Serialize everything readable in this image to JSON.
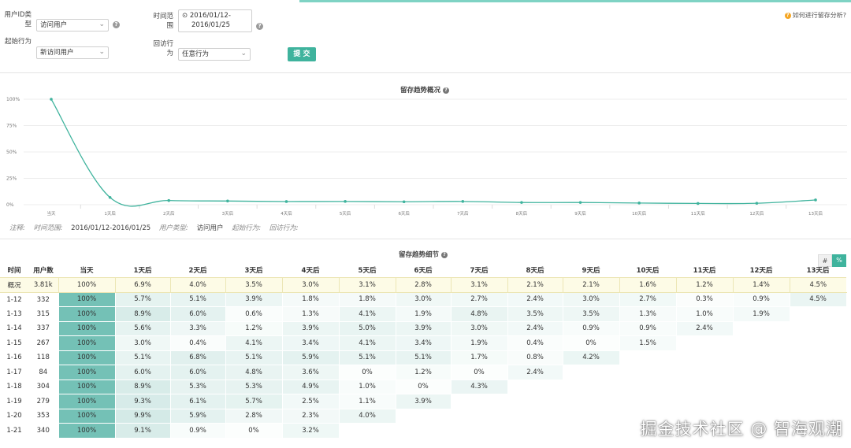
{
  "filters": {
    "user_id_type_label": "用户ID类型",
    "user_id_type_value": "访问用户",
    "start_action_label": "起始行为",
    "start_action_value": "新访问用户",
    "time_range_label": "时间范围",
    "time_range_start": "2016/01/12-",
    "time_range_end": "2016/01/25",
    "return_action_label": "回访行为",
    "return_action_value": "任意行为",
    "submit_label": "提 交",
    "help_link": "如何进行留存分析?"
  },
  "overview": {
    "title": "留存趋势概况"
  },
  "chart_data": {
    "type": "line",
    "title": "留存趋势概况",
    "categories": [
      "当天",
      "1天后",
      "2天后",
      "3天后",
      "4天后",
      "5天后",
      "6天后",
      "7天后",
      "8天后",
      "9天后",
      "10天后",
      "11天后",
      "12天后",
      "13天后"
    ],
    "y_tick_labels": [
      "100%",
      "75%",
      "50%",
      "25%",
      "0%"
    ],
    "ylim": [
      0,
      100
    ],
    "series": [
      {
        "values": [
          100,
          6.9,
          4.0,
          3.5,
          3.0,
          3.1,
          2.8,
          3.1,
          2.1,
          2.1,
          1.6,
          1.2,
          1.4,
          4.5
        ]
      }
    ],
    "color": "#3fb39d",
    "grid": true
  },
  "note": {
    "prefix": "注释:",
    "time_key": "时间范围:",
    "time_value": "2016/01/12-2016/01/25",
    "user_type_key": "用户类型:",
    "user_type_value": "访问用户",
    "start_key": "起始行为:",
    "return_key": "回访行为:"
  },
  "detail": {
    "title": "留存趋势细节",
    "toggle_count": "#",
    "toggle_percent": "%",
    "headers": [
      "时间",
      "用户数",
      "当天",
      "1天后",
      "2天后",
      "3天后",
      "4天后",
      "5天后",
      "6天后",
      "7天后",
      "8天后",
      "9天后",
      "10天后",
      "11天后",
      "12天后",
      "13天后"
    ],
    "summary": {
      "label": "概况",
      "users": "3.81k",
      "values": [
        "100%",
        "6.9%",
        "4.0%",
        "3.5%",
        "3.0%",
        "3.1%",
        "2.8%",
        "3.1%",
        "2.1%",
        "2.1%",
        "1.6%",
        "1.2%",
        "1.4%",
        "4.5%"
      ]
    },
    "rows": [
      {
        "date": "1-12",
        "users": "332",
        "values": [
          "100%",
          "5.7%",
          "5.1%",
          "3.9%",
          "1.8%",
          "1.8%",
          "3.0%",
          "2.7%",
          "2.4%",
          "3.0%",
          "2.7%",
          "0.3%",
          "0.9%",
          "4.5%"
        ]
      },
      {
        "date": "1-13",
        "users": "315",
        "values": [
          "100%",
          "8.9%",
          "6.0%",
          "0.6%",
          "1.3%",
          "4.1%",
          "1.9%",
          "4.8%",
          "3.5%",
          "3.5%",
          "1.3%",
          "1.0%",
          "1.9%"
        ]
      },
      {
        "date": "1-14",
        "users": "337",
        "values": [
          "100%",
          "5.6%",
          "3.3%",
          "1.2%",
          "3.9%",
          "5.0%",
          "3.9%",
          "3.0%",
          "2.4%",
          "0.9%",
          "0.9%",
          "2.4%"
        ]
      },
      {
        "date": "1-15",
        "users": "267",
        "values": [
          "100%",
          "3.0%",
          "0.4%",
          "4.1%",
          "3.4%",
          "4.1%",
          "3.4%",
          "1.9%",
          "0.4%",
          "0%",
          "1.5%"
        ]
      },
      {
        "date": "1-16",
        "users": "118",
        "values": [
          "100%",
          "5.1%",
          "6.8%",
          "5.1%",
          "5.9%",
          "5.1%",
          "5.1%",
          "1.7%",
          "0.8%",
          "4.2%"
        ]
      },
      {
        "date": "1-17",
        "users": "84",
        "values": [
          "100%",
          "6.0%",
          "6.0%",
          "4.8%",
          "3.6%",
          "0%",
          "1.2%",
          "0%",
          "2.4%"
        ]
      },
      {
        "date": "1-18",
        "users": "304",
        "values": [
          "100%",
          "8.9%",
          "5.3%",
          "5.3%",
          "4.9%",
          "1.0%",
          "0%",
          "4.3%"
        ]
      },
      {
        "date": "1-19",
        "users": "279",
        "values": [
          "100%",
          "9.3%",
          "6.1%",
          "5.7%",
          "2.5%",
          "1.1%",
          "3.9%"
        ]
      },
      {
        "date": "1-20",
        "users": "353",
        "values": [
          "100%",
          "9.9%",
          "5.9%",
          "2.8%",
          "2.3%",
          "4.0%"
        ]
      },
      {
        "date": "1-21",
        "users": "340",
        "values": [
          "100%",
          "9.1%",
          "0.9%",
          "0%",
          "3.2%"
        ]
      }
    ]
  },
  "watermark": "掘金技术社区 @ 智海观潮"
}
